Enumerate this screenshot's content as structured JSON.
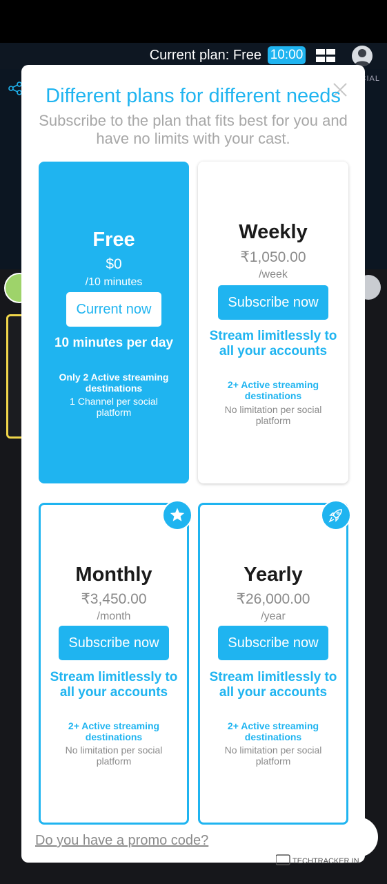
{
  "topbar": {
    "plan_label": "Current plan: Free",
    "time": "10:00",
    "layout_icon": "grid-layout-icon",
    "avatar_icon": "user-avatar-icon"
  },
  "background": {
    "social_label": "CIAL"
  },
  "modal": {
    "title": "Different plans for different needs",
    "subtitle": "Subscribe to the plan that fits best for you and have no limits with your cast.",
    "close_icon": "close-icon",
    "promo": "Do you have a promo code?"
  },
  "plans": {
    "free": {
      "name": "Free",
      "price": "$0",
      "period": "/10 minutes",
      "button": "Current now",
      "feature": "10 minutes per day",
      "destinations": "Only 2 Active streaming destinations",
      "limit": "1 Channel per social platform"
    },
    "weekly": {
      "name": "Weekly",
      "price": "₹1,050.00",
      "period": "/week",
      "button": "Subscribe now",
      "feature": "Stream limitlessly to all your accounts",
      "destinations": "2+ Active streaming destinations",
      "limit": "No limitation per social platform"
    },
    "monthly": {
      "name": "Monthly",
      "price": "₹3,450.00",
      "period": "/month",
      "button": "Subscribe now",
      "feature": "Stream limitlessly to all your accounts",
      "destinations": "2+ Active streaming destinations",
      "limit": "No limitation per social platform",
      "badge_icon": "star-icon"
    },
    "yearly": {
      "name": "Yearly",
      "price": "₹26,000.00",
      "period": "/year",
      "button": "Subscribe now",
      "feature": "Stream limitlessly to all your accounts",
      "destinations": "2+ Active streaming destinations",
      "limit": "No limitation per social platform",
      "badge_icon": "rocket-icon"
    }
  },
  "watermark": "TECHTRACKER.IN",
  "colors": {
    "accent": "#1fb4f0",
    "text_dark": "#1a1a1a",
    "text_grey": "#8a8a8a"
  }
}
